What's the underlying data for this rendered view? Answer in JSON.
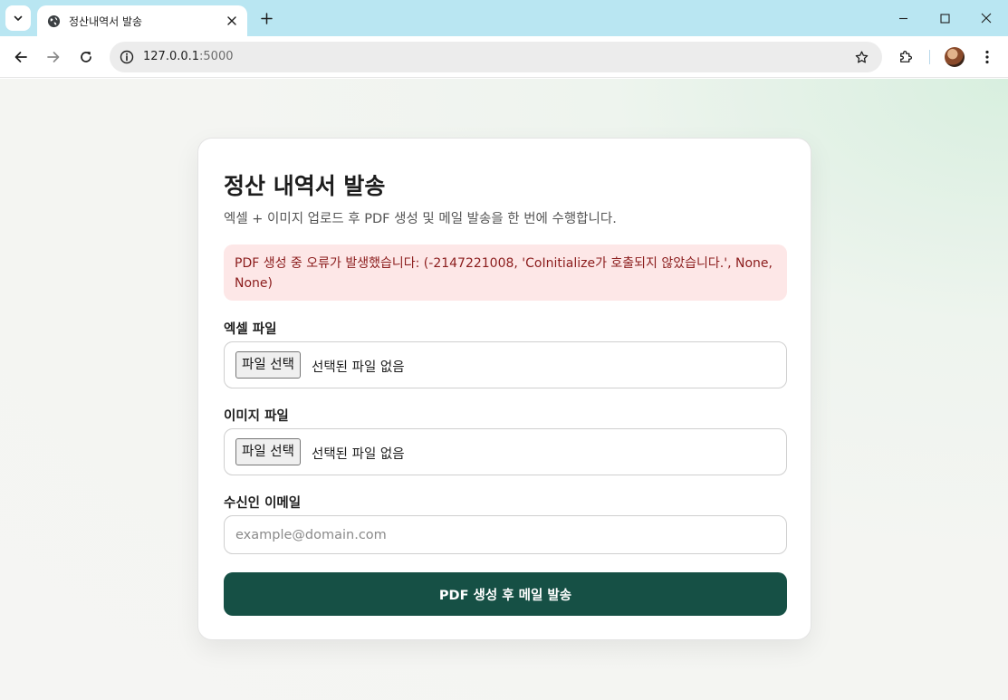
{
  "browser": {
    "tab_title": "정산내역서 발송",
    "url_host": "127.0.0.1",
    "url_port": ":5000"
  },
  "page": {
    "title": "정산 내역서 발송",
    "subtitle": "엑셀 + 이미지 업로드 후 PDF 생성 및 메일 발송을 한 번에 수행합니다.",
    "error_message": "PDF 생성 중 오류가 발생했습니다: (-2147221008, 'CoInitialize가 호출되지 않았습니다.', None, None)",
    "excel_field": {
      "label": "엑셀 파일",
      "button_label": "파일 선택",
      "status": "선택된 파일 없음"
    },
    "image_field": {
      "label": "이미지 파일",
      "button_label": "파일 선택",
      "status": "선택된 파일 없음"
    },
    "email_field": {
      "label": "수신인 이메일",
      "value": "",
      "placeholder": "example@domain.com"
    },
    "submit_label": "PDF 생성 후 메일 발송"
  },
  "colors": {
    "tabbar": "#b9e6f2",
    "primary_button": "#165045",
    "alert_background": "#fde7e7",
    "alert_text": "#8b1c1c"
  }
}
